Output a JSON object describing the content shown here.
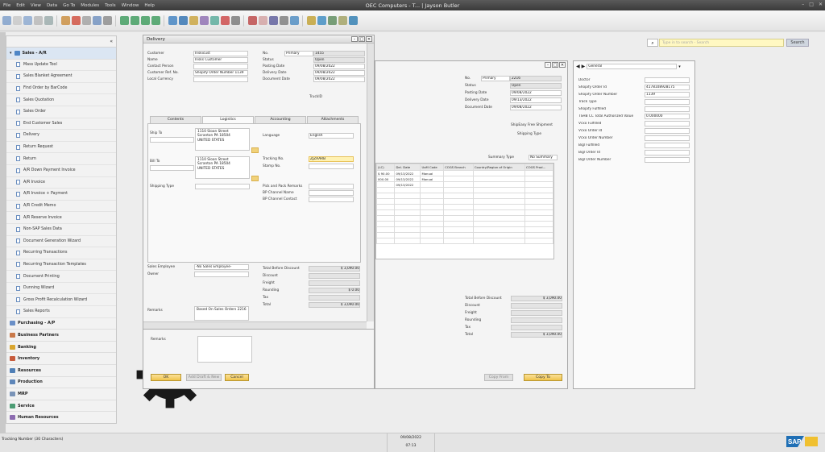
{
  "app": {
    "window_title": "OEC Computers - T... | Jayson Butler",
    "menu": [
      "File",
      "Edit",
      "View",
      "Data",
      "Go To",
      "Modules",
      "Tools",
      "Window",
      "Help"
    ]
  },
  "sidebar": {
    "collapse_glyph": "«",
    "modules_top": {
      "label": "Sales - A/R",
      "open_glyph": "▾"
    },
    "items": [
      "Mass Update Tool",
      "Sales Blanket Agreement",
      "Find Order by BarCode",
      "Sales Quotation",
      "Sales Order",
      "End Customer Sales",
      "Delivery",
      "Return Request",
      "Return",
      "A/R Down Payment Invoice",
      "A/R Invoice",
      "A/R Invoice + Payment",
      "A/R Credit Memo",
      "A/R Reserve Invoice",
      "Non-SAP Sales Data",
      "Document Generation Wizard",
      "Recurring Transactions",
      "Recurring Transaction Templates",
      "Document Printing",
      "Dunning Wizard",
      "Gross Profit Recalculation Wizard",
      "Sales Reports"
    ],
    "modules": [
      {
        "label": "Purchasing - A/P",
        "color": "#6a8fc7"
      },
      {
        "label": "Business Partners",
        "color": "#c9794a"
      },
      {
        "label": "Banking",
        "color": "#d9a52e"
      },
      {
        "label": "Inventory",
        "color": "#c75b3c"
      },
      {
        "label": "Resources",
        "color": "#4f7fb6"
      },
      {
        "label": "Production",
        "color": "#5e86b9"
      },
      {
        "label": "MRP",
        "color": "#7a94b8"
      },
      {
        "label": "Service",
        "color": "#4c9c74"
      },
      {
        "label": "Human Resources",
        "color": "#8c6bb0"
      }
    ]
  },
  "search": {
    "placeholder": "Type in to search - Search",
    "button": "Search"
  },
  "delivery": {
    "title": "Delivery",
    "header_left": [
      {
        "label": "Customer",
        "value": "Inskicust"
      },
      {
        "label": "Name",
        "value": "Insks Customer"
      },
      {
        "label": "Contact Person",
        "value": ""
      },
      {
        "label": "Customer Ref. No.",
        "value": "Shopify Order Number 1139"
      },
      {
        "label": "Local Currency",
        "value": ""
      }
    ],
    "header_right": [
      {
        "label": "No.",
        "series": "Primary",
        "value": "1455"
      },
      {
        "label": "Status",
        "value": "Open"
      },
      {
        "label": "Posting Date",
        "value": "09/08/2022"
      },
      {
        "label": "Delivery Date",
        "value": "09/08/2022"
      },
      {
        "label": "Document Date",
        "value": "09/08/2022"
      }
    ],
    "truck_label": "TruckID",
    "tabs": [
      "Contents",
      "Logistics",
      "Accounting",
      "Attachments"
    ],
    "active_tab": "Logistics",
    "ship_to": {
      "label": "Ship To",
      "address": "1110 Sloan Street\nScranton PA 18504\nUNITED STATES"
    },
    "bill_to": {
      "label": "Bill To",
      "address": "1110 Sloan Street\nScranton PA 18504\nUNITED STATES"
    },
    "shipping_type_label": "Shipping Type",
    "language": {
      "label": "Language",
      "value": "English"
    },
    "tracking": {
      "label": "Tracking No.",
      "value": "ZJZAARB"
    },
    "stamp_label": "Stamp No.",
    "pick_labels": [
      "Pick and Pack Remarks",
      "BP Channel Name",
      "BP Channel Contact"
    ],
    "sales_employee": {
      "label": "Sales Employee",
      "value": "-No Sales Employee-"
    },
    "owner_label": "Owner",
    "remarks": {
      "label": "Remarks",
      "value": "Based On Sales Orders 2216"
    },
    "totals": [
      {
        "label": "Total Before Discount",
        "value": "$ 3,090.00"
      },
      {
        "label": "Discount",
        "value": ""
      },
      {
        "label": "Freight",
        "value": ""
      },
      {
        "label": "Rounding",
        "value": "$ 0.00"
      },
      {
        "label": "Tax",
        "value": ""
      },
      {
        "label": "Total",
        "value": "$ 3,090.00"
      }
    ],
    "bottom_remarks_label": "Remarks",
    "buttons": {
      "ok": "OK",
      "draft": "Add Draft & New",
      "cancel": "Cancel"
    }
  },
  "background_doc": {
    "header_right": [
      {
        "label": "No.",
        "series": "Primary",
        "value": "2216"
      },
      {
        "label": "Status",
        "value": "Open"
      },
      {
        "label": "Posting Date",
        "value": "09/08/2022"
      },
      {
        "label": "Delivery Date",
        "value": "09/13/2022"
      },
      {
        "label": "Document Date",
        "value": "09/08/2022"
      }
    ],
    "shipeasy_label": "ShipEasy Free Shipment",
    "shipping_type_label": "Shipping Type",
    "summary_type": {
      "label": "Summary Type",
      "value": "No Summary"
    },
    "grid_headers": [
      "(LC)",
      "Del. Date",
      "UoM Code",
      "COGS Branch",
      "Country/Region of Origin",
      "COGS Prod..."
    ],
    "grid_rows": [
      [
        "$ 90.00",
        "09/13/2022",
        "Manual",
        "",
        "",
        ""
      ],
      [
        "000.00",
        "09/13/2022",
        "Manual",
        "",
        "",
        ""
      ],
      [
        "",
        "09/13/2022",
        "",
        "",
        "",
        ""
      ]
    ],
    "totals": [
      {
        "label": "Total Before Discount",
        "value": "$ 3,090.00"
      },
      {
        "label": "Discount",
        "value": ""
      },
      {
        "label": "Freight",
        "value": ""
      },
      {
        "label": "Rounding",
        "value": ""
      },
      {
        "label": "Tax",
        "value": ""
      },
      {
        "label": "Total",
        "value": "$ 3,090.00"
      }
    ],
    "buttons": {
      "copy_from": "Copy From",
      "copy_to": "Copy To"
    }
  },
  "udf_panel": {
    "dropdown": "General",
    "fields": [
      {
        "label": "Doctor",
        "value": ""
      },
      {
        "label": "Shopify Order Id",
        "value": "4178108928175"
      },
      {
        "label": "Shopify Order Number",
        "value": "1139"
      },
      {
        "label": "Track Type",
        "value": ""
      },
      {
        "label": "Shopify Fulfilled",
        "value": ""
      },
      {
        "label": "TSHB CC Total Authorized Value",
        "value": "0.000000"
      },
      {
        "label": "Vcxo Fulfilled",
        "value": ""
      },
      {
        "label": "Vcxo Order Id",
        "value": ""
      },
      {
        "label": "Vcxo Order Number",
        "value": ""
      },
      {
        "label": "Bigl Fulfilled",
        "value": ""
      },
      {
        "label": "Bigl Order Id",
        "value": ""
      },
      {
        "label": "Bigl Order Number",
        "value": ""
      }
    ]
  },
  "status": {
    "message": "Tracking Number (30 Characters)",
    "date": "09/08/2022",
    "time": "07:13"
  },
  "colors": {
    "accent_yellow": "#f0c34a",
    "selected_blue": "#dbe6f3"
  }
}
